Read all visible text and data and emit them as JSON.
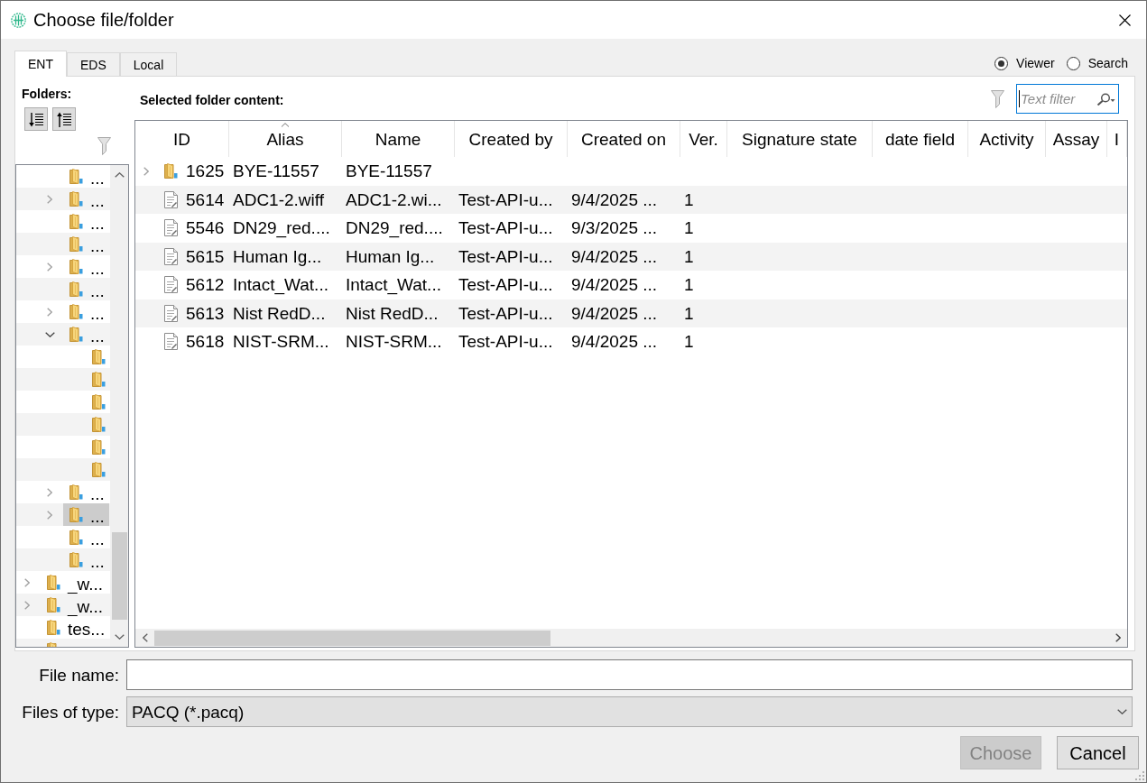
{
  "window": {
    "title": "Choose file/folder"
  },
  "tabs": [
    {
      "label": "ENT",
      "selected": true
    },
    {
      "label": "EDS",
      "selected": false
    },
    {
      "label": "Local",
      "selected": false
    }
  ],
  "view_mode": [
    {
      "label": "Viewer",
      "selected": true
    },
    {
      "label": "Search",
      "selected": false
    }
  ],
  "folders": {
    "title": "Folders:",
    "tree": [
      {
        "children": [
          {
            "kind": "leaf",
            "label": "...",
            "expanded": false,
            "selected": false
          },
          {
            "kind": "branch",
            "label": "...",
            "expanded": false,
            "selected": false
          },
          {
            "kind": "leaf",
            "label": "...",
            "expanded": false,
            "selected": false
          },
          {
            "kind": "leaf",
            "label": "...",
            "expanded": false,
            "selected": false
          },
          {
            "kind": "branch",
            "label": "...",
            "expanded": false,
            "selected": false
          },
          {
            "kind": "leaf",
            "label": "...",
            "expanded": false,
            "selected": false
          },
          {
            "kind": "branch",
            "label": "...",
            "expanded": false,
            "selected": false
          },
          {
            "kind": "branch",
            "label": "...",
            "expanded": true,
            "selected": false,
            "children": [
              {
                "kind": "leaf",
                "expanded": false,
                "selected": false
              },
              {
                "kind": "leaf",
                "expanded": false,
                "selected": false
              },
              {
                "kind": "leaf",
                "expanded": false,
                "selected": false
              },
              {
                "kind": "leaf",
                "expanded": false,
                "selected": false
              },
              {
                "kind": "leaf",
                "expanded": false,
                "selected": false
              },
              {
                "kind": "leaf",
                "expanded": false,
                "selected": false
              }
            ]
          },
          {
            "kind": "branch",
            "label": "...",
            "expanded": false,
            "selected": false
          },
          {
            "kind": "branch",
            "label": "...",
            "expanded": false,
            "selected": true
          },
          {
            "kind": "leaf",
            "label": "...",
            "expanded": false,
            "selected": false
          },
          {
            "kind": "leaf",
            "label": "...",
            "expanded": false,
            "selected": false
          }
        ]
      },
      {
        "kind": "branch",
        "label": "_w...",
        "expanded": false,
        "selected": false
      },
      {
        "kind": "branch",
        "label": "_w...",
        "expanded": false,
        "selected": false
      },
      {
        "kind": "leaf",
        "label": "tes...",
        "expanded": false,
        "selected": false
      },
      {
        "kind": "leaf",
        "expanded": false,
        "selected": false
      }
    ]
  },
  "content": {
    "title": "Selected folder content:",
    "text_filter": {
      "placeholder": "Text filter",
      "focused": true
    },
    "table": {
      "columns": [
        {
          "label": "ID",
          "sorted": false
        },
        {
          "label": "Alias",
          "sorted": true
        },
        {
          "label": "Name",
          "sorted": false
        },
        {
          "label": "Created by",
          "sorted": false
        },
        {
          "label": "Created on",
          "sorted": false
        },
        {
          "label": "Ver.",
          "sorted": false
        },
        {
          "label": "Signature state",
          "sorted": false
        },
        {
          "label": "date field",
          "sorted": false
        },
        {
          "label": "Activity",
          "sorted": false
        },
        {
          "label": "Assay",
          "sorted": false
        },
        {
          "label": "I",
          "sorted": false
        }
      ],
      "rows": [
        {
          "kind": "folder",
          "cells": [
            "1625",
            "BYE-11557",
            "BYE-11557"
          ]
        },
        {
          "kind": "file",
          "cells": [
            "5614",
            "ADC1-2.wiff",
            "ADC1-2.wi...",
            "Test-API-u...",
            "9/4/2025 ...",
            "1"
          ]
        },
        {
          "kind": "file",
          "cells": [
            "5546",
            "DN29_red....",
            "DN29_red....",
            "Test-API-u...",
            "9/3/2025 ...",
            "1"
          ]
        },
        {
          "kind": "file",
          "cells": [
            "5615",
            "Human Ig...",
            "Human Ig...",
            "Test-API-u...",
            "9/4/2025 ...",
            "1"
          ]
        },
        {
          "kind": "file",
          "cells": [
            "5612",
            "Intact_Wat...",
            "Intact_Wat...",
            "Test-API-u...",
            "9/4/2025 ...",
            "1"
          ]
        },
        {
          "kind": "file",
          "cells": [
            "5613",
            "Nist RedD...",
            "Nist RedD...",
            "Test-API-u...",
            "9/4/2025 ...",
            "1"
          ]
        },
        {
          "kind": "file",
          "cells": [
            "5618",
            "NIST-SRM...",
            "NIST-SRM...",
            "Test-API-u...",
            "9/4/2025 ...",
            "1"
          ]
        }
      ]
    }
  },
  "file_name": {
    "label": "File name:"
  },
  "file_type": {
    "label": "Files of type:",
    "value": "PACQ (*.pacq)"
  },
  "buttons": [
    {
      "label": "Choose",
      "disabled": true
    },
    {
      "label": "Cancel",
      "disabled": false
    }
  ]
}
